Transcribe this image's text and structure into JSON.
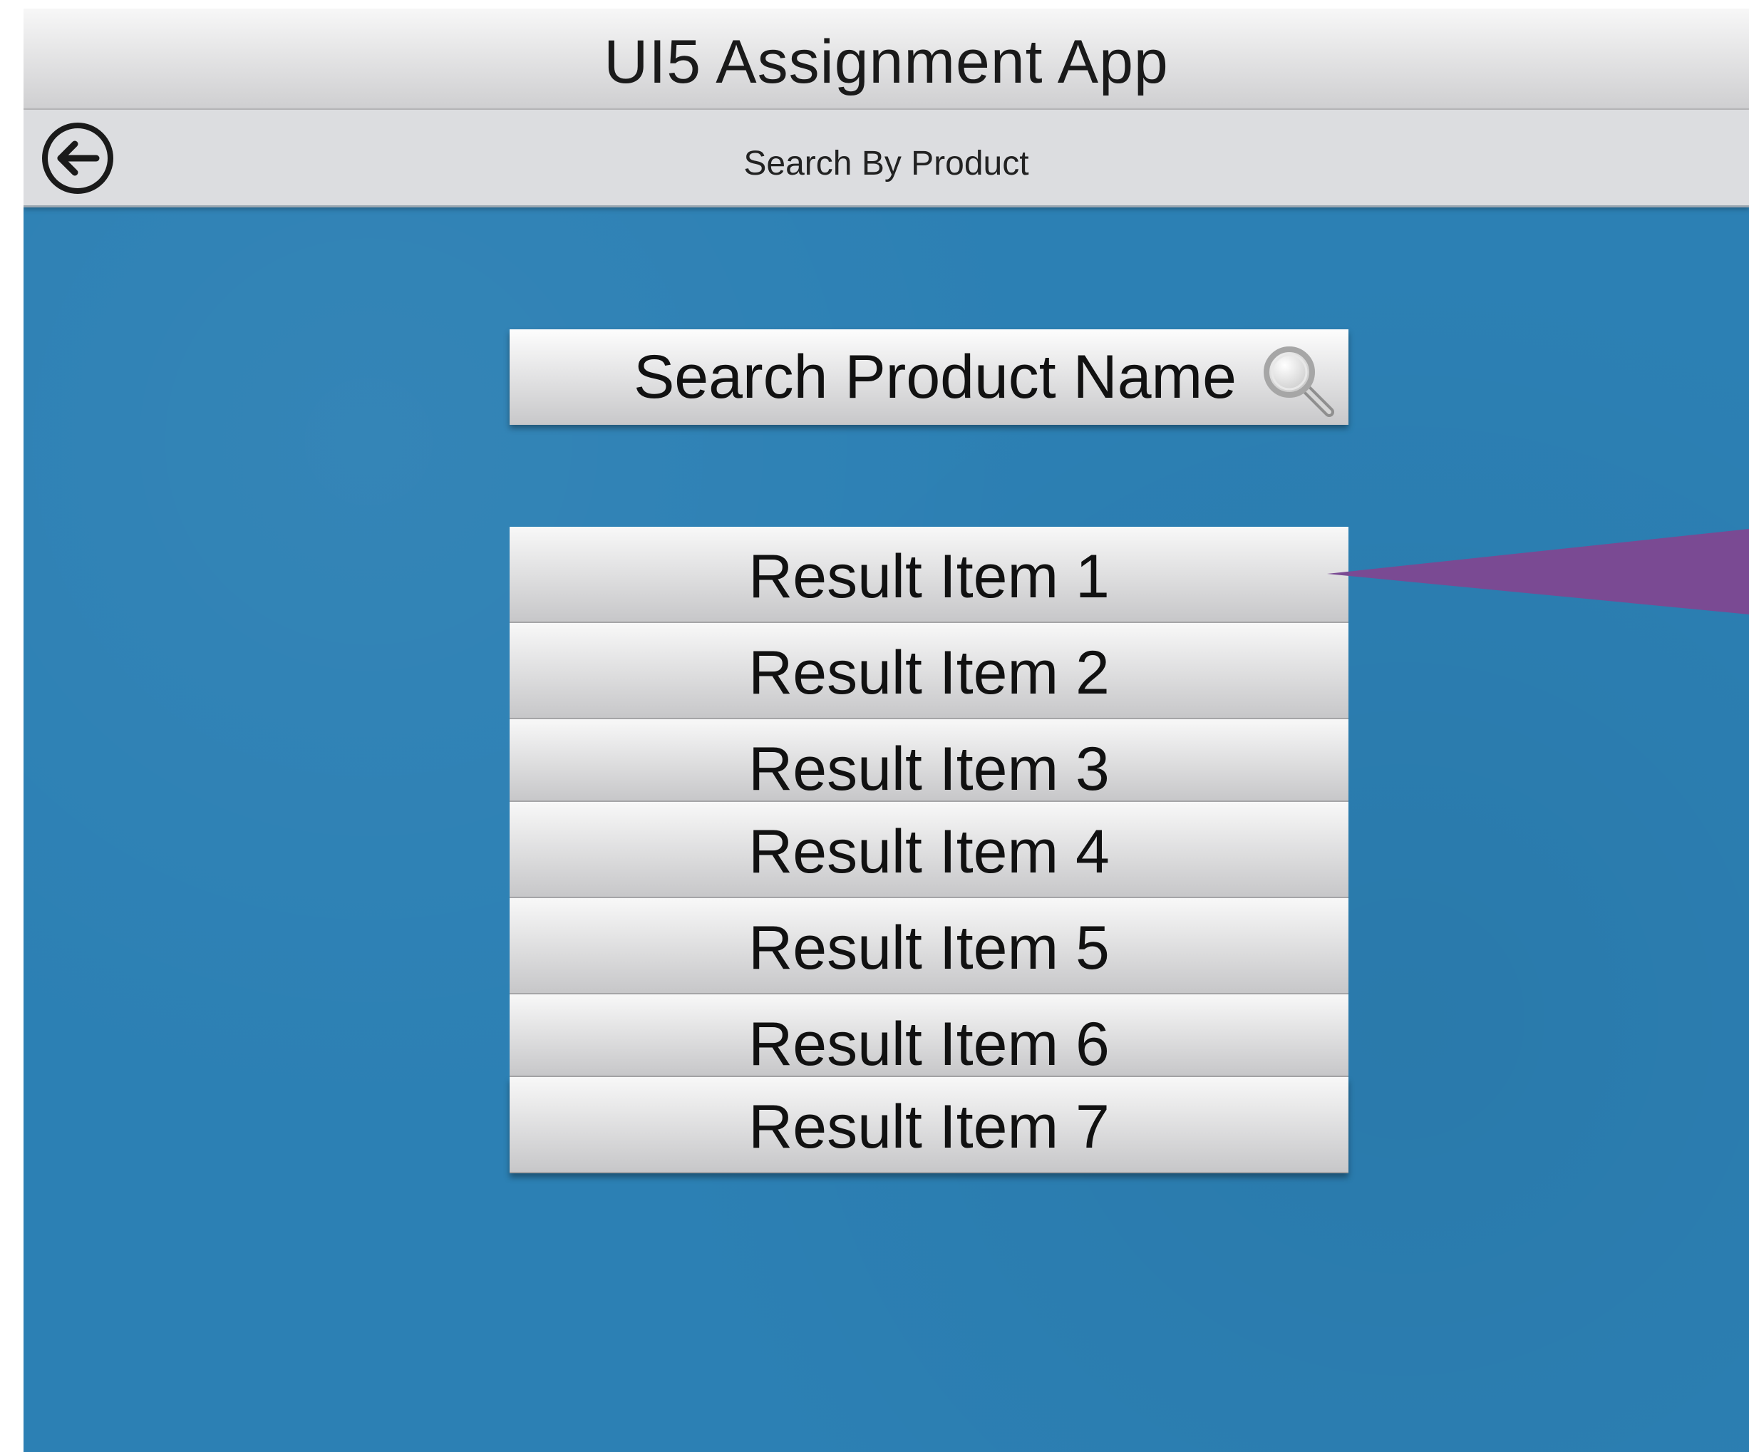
{
  "app": {
    "title": "UI5 Assignment App",
    "background_color": "#2c80b4"
  },
  "nav": {
    "title": "Search By Product",
    "back_icon": "arrow-left-circle-icon"
  },
  "search": {
    "placeholder": "Search Product Name",
    "icon": "magnifier-icon"
  },
  "results": {
    "items": [
      {
        "label": "Result Item 1"
      },
      {
        "label": "Result Item 2"
      },
      {
        "label": "Result Item 3"
      },
      {
        "label": "Result Item 4"
      },
      {
        "label": "Result Item 5"
      },
      {
        "label": "Result Item 6"
      },
      {
        "label": "Result Item 7"
      }
    ]
  },
  "callout": {
    "color": "#7a4a93"
  }
}
